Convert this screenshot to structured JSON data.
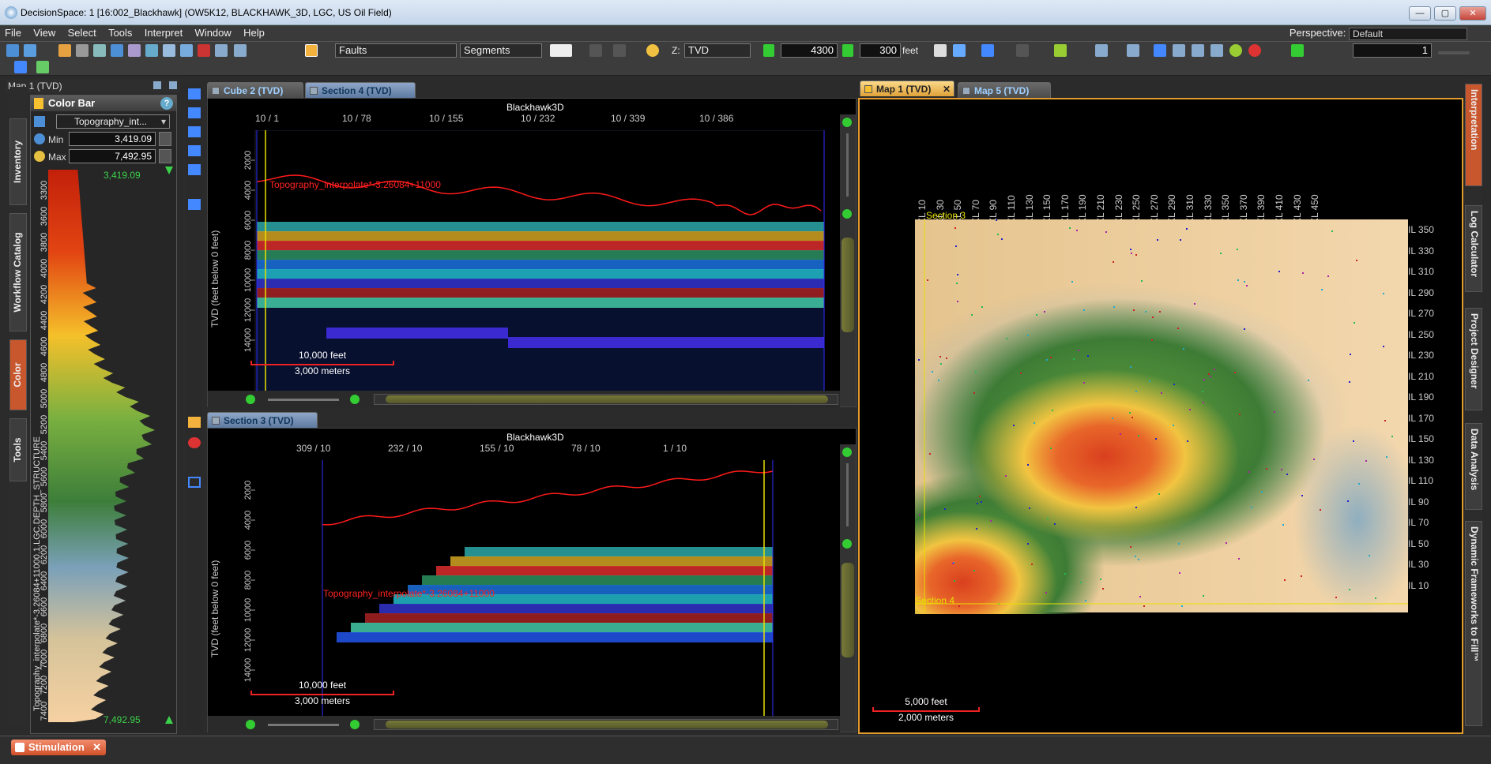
{
  "window": {
    "title": "DecisionSpace: 1 [16:002_Blackhawk] (OW5K12, BLACKHAWK_3D, LGC, US Oil Field)",
    "minimize": "—",
    "maximize": "▢",
    "close": "✕"
  },
  "menu": {
    "items": [
      "File",
      "View",
      "Select",
      "Tools",
      "Interpret",
      "Window",
      "Help"
    ],
    "perspective_label": "Perspective:",
    "perspective_value": "Default"
  },
  "toolbar": {
    "faults_select": "Faults",
    "segments_select": "Segments",
    "z_label": "Z:",
    "z_select": "TVD",
    "depth_value": "4300",
    "step_value": "300",
    "step_unit": "feet",
    "count_value": "1"
  },
  "left_panel": {
    "view_title": "Map 1 (TVD)",
    "color_bar_title": "Color Bar",
    "attribute_select": "Topography_int...",
    "min_label": "Min",
    "min_value": "3,419.09",
    "max_label": "Max",
    "max_value": "7,492.95",
    "top_value": "3,419.09",
    "bottom_value": "7,492.95",
    "axis_label": "Topography_interpolate*-3.26084+11000.1.LGC.DEPTH_STRUCTURE",
    "ticks": [
      "3300",
      "3600",
      "3800",
      "4000",
      "4200",
      "4400",
      "4600",
      "4800",
      "5000",
      "5200",
      "5400",
      "5600",
      "5800",
      "6000",
      "6200",
      "6400",
      "6600",
      "6800",
      "7000",
      "7200",
      "7400"
    ],
    "vtabs": [
      "Inventory",
      "Workflow Catalog",
      "Color",
      "Tools"
    ]
  },
  "section4": {
    "tab_cube": "Cube 2 (TVD)",
    "tab_section": "Section 4 (TVD)",
    "survey": "Blackhawk3D",
    "top_ticks": [
      "10 / 1",
      "10 / 78",
      "10 / 155",
      "10 / 232",
      "10 / 339",
      "10 / 386"
    ],
    "ylabel": "TVD (feet below 0 feet)",
    "y_ticks": [
      "2000",
      "4000",
      "6000",
      "8000",
      "10000",
      "12000",
      "14000"
    ],
    "horizon_label": "Topography_interpolate*-3.26084+11000",
    "scale_feet": "10,000 feet",
    "scale_meters": "3,000 meters"
  },
  "section3": {
    "tab_section": "Section 3 (TVD)",
    "survey": "Blackhawk3D",
    "top_ticks": [
      "309 / 10",
      "232 / 10",
      "155 / 10",
      "78 / 10",
      "1 / 10"
    ],
    "ylabel": "TVD (feet below 0 feet)",
    "y_ticks": [
      "2000",
      "4000",
      "6000",
      "8000",
      "10000",
      "12000",
      "14000"
    ],
    "horizon_label": "Topography_interpolate*-3.26084+11000",
    "scale_feet": "10,000 feet",
    "scale_meters": "3,000 meters"
  },
  "map": {
    "tab_map1": "Map 1 (TVD)",
    "tab_map5": "Map 5 (TVD)",
    "xl_ticks": [
      "XL 10",
      "XL 30",
      "XL 50",
      "XL 70",
      "XL 90",
      "XL 110",
      "XL 130",
      "XL 150",
      "XL 170",
      "XL 190",
      "XL 210",
      "XL 230",
      "XL 250",
      "XL 270",
      "XL 290",
      "XL 310",
      "XL 330",
      "XL 350",
      "XL 370",
      "XL 390",
      "XL 410",
      "XL 430",
      "XL 450"
    ],
    "il_ticks": [
      "IL 350",
      "IL 330",
      "IL 310",
      "IL 290",
      "IL 270",
      "IL 250",
      "IL 230",
      "IL 210",
      "IL 190",
      "IL 170",
      "IL 150",
      "IL 130",
      "IL 110",
      "IL 90",
      "IL 70",
      "IL 50",
      "IL 30",
      "IL 10"
    ],
    "section3_label": "Section 3",
    "section4_label": "Section 4",
    "scale_feet": "5,000 feet",
    "scale_meters": "2,000 meters"
  },
  "right_tabs": [
    "Interpretation",
    "Log Calculator",
    "Project Designer",
    "Data Analysis",
    "Dynamic Frameworks to Fill™"
  ],
  "status": {
    "stimulation_tab": "Stimulation"
  },
  "colors": {
    "accent_orange": "#e39a2a",
    "horizon_red": "#ff1a1a",
    "section_yellow": "#e8e000"
  }
}
